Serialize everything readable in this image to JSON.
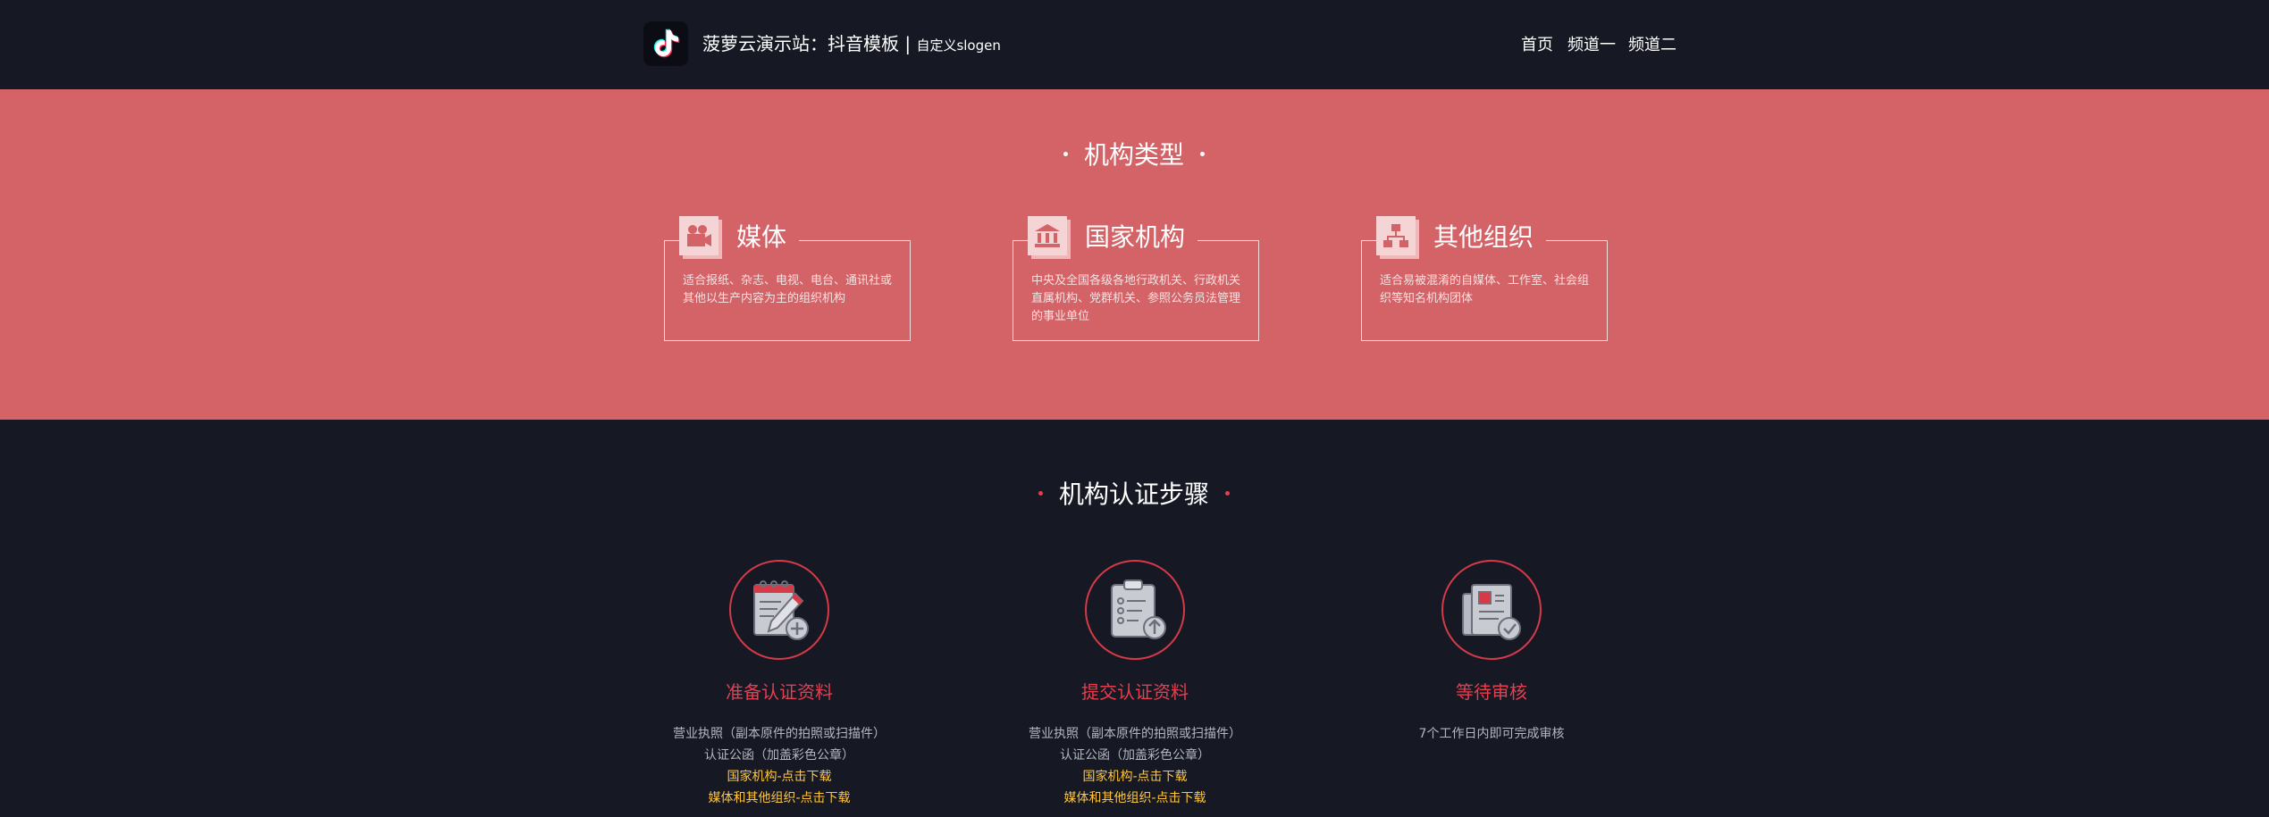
{
  "header": {
    "site_title": "菠萝云演示站：抖音模板",
    "separator": " | ",
    "slogan": "自定义slogen",
    "nav": [
      {
        "label": "首页"
      },
      {
        "label": "频道一"
      },
      {
        "label": "频道二"
      }
    ]
  },
  "org_types": {
    "title": "机构类型",
    "cards": [
      {
        "title": "媒体",
        "icon": "video-camera-icon",
        "desc": "适合报纸、杂志、电视、电台、通讯社或其他以生产内容为主的组织机构"
      },
      {
        "title": "国家机构",
        "icon": "government-building-icon",
        "desc": "中央及全国各级各地行政机关、行政机关直属机构、党群机关、参照公务员法管理的事业单位"
      },
      {
        "title": "其他组织",
        "icon": "org-chart-icon",
        "desc": "适合易被混淆的自媒体、工作室、社会组织等知名机构团体"
      }
    ]
  },
  "steps": {
    "title": "机构认证步骤",
    "items": [
      {
        "name": "准备认证资料",
        "icon": "notepad-add-icon",
        "lines": [
          "营业执照（副本原件的拍照或扫描件）",
          "认证公函（加盖彩色公章）"
        ],
        "links": [
          "国家机构-点击下载",
          "媒体和其他组织-点击下载"
        ]
      },
      {
        "name": "提交认证资料",
        "icon": "clipboard-upload-icon",
        "lines": [
          "营业执照（副本原件的拍照或扫描件）",
          "认证公函（加盖彩色公章）"
        ],
        "links": [
          "国家机构-点击下载",
          "媒体和其他组织-点击下载"
        ]
      },
      {
        "name": "等待审核",
        "icon": "document-check-icon",
        "lines": [
          "7个工作日内即可完成审核"
        ],
        "links": []
      }
    ]
  },
  "colors": {
    "dark_bg": "#161823",
    "coral_bg": "#d46367",
    "accent_red": "#e53f50",
    "link_yellow": "#ffc53d"
  }
}
